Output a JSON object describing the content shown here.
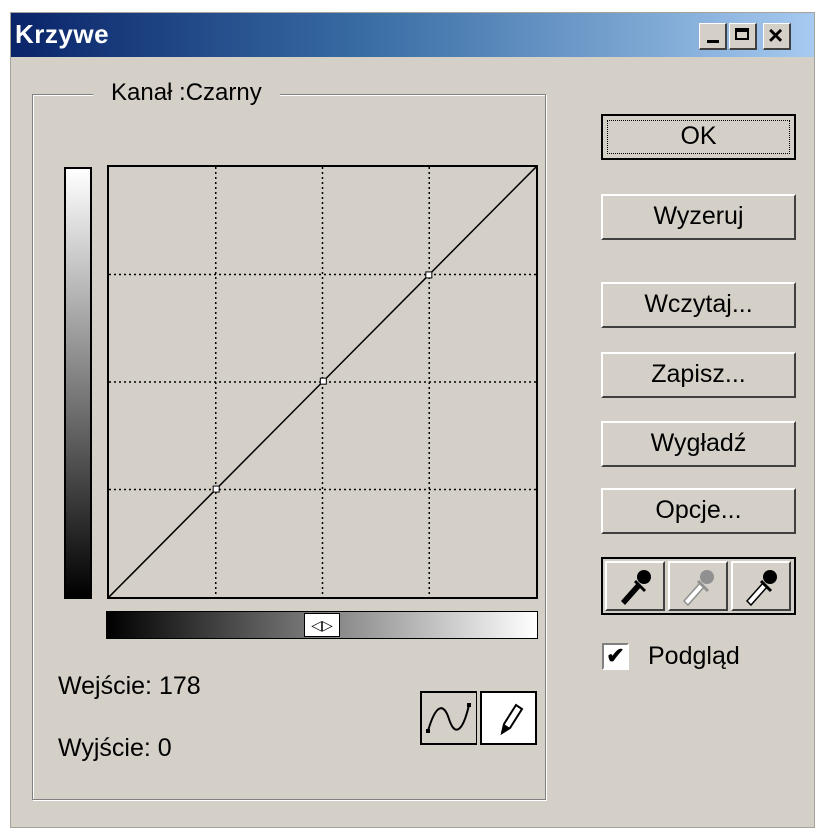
{
  "window": {
    "title": "Krzywe",
    "controls": {
      "minimize": "minimize-icon",
      "maximize": "maximize-icon",
      "close": "close-icon"
    }
  },
  "group": {
    "label": "Kanał :Czarny"
  },
  "curve": {
    "grid_divisions": 4,
    "points": [
      [
        0,
        0
      ],
      [
        64,
        64
      ],
      [
        128,
        128
      ],
      [
        191,
        191
      ],
      [
        255,
        255
      ]
    ]
  },
  "readouts": {
    "input": "Wejście: 178",
    "output": "Wyjście: 0"
  },
  "buttons": {
    "ok": "OK",
    "reset": "Wyzeruj",
    "load": "Wczytaj...",
    "save": "Zapisz...",
    "smooth": "Wygładź",
    "options": "Opcje..."
  },
  "preview": {
    "label": "Podgląd",
    "checked": true,
    "check_glyph": "✔"
  },
  "tools": {
    "curve": "curve-tool-icon",
    "pencil": "pencil-tool-icon"
  },
  "eyedroppers": [
    "black-eyedropper-icon",
    "gray-eyedropper-icon",
    "white-eyedropper-icon"
  ],
  "toggle": "◁▷",
  "colors": {
    "title_start": "#0a246a",
    "title_end": "#a6caf0",
    "face": "#d4d0c8"
  }
}
